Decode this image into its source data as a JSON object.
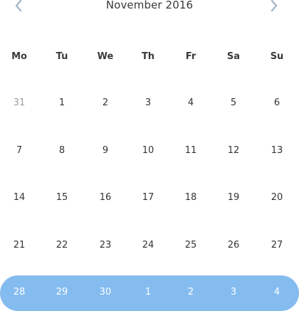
{
  "calendar": {
    "title": "November 2016",
    "weekdays": [
      "Mo",
      "Tu",
      "We",
      "Th",
      "Fr",
      "Sa",
      "Su"
    ],
    "weeks": [
      [
        "31",
        "1",
        "2",
        "3",
        "4",
        "5",
        "6"
      ],
      [
        "7",
        "8",
        "9",
        "10",
        "11",
        "12",
        "13"
      ],
      [
        "14",
        "15",
        "16",
        "17",
        "18",
        "19",
        "20"
      ],
      [
        "21",
        "22",
        "23",
        "24",
        "25",
        "26",
        "27"
      ],
      [
        "28",
        "29",
        "30",
        "1",
        "2",
        "3",
        "4"
      ]
    ],
    "muted_cells": [
      "0-0"
    ],
    "selected_week_index": 4
  },
  "icons": {
    "prev": "chevron-left-icon",
    "next": "chevron-right-icon"
  },
  "colors": {
    "highlight": "#85bcef",
    "text": "#333333",
    "muted": "#9e9e9e",
    "nav": "#a7b6c4"
  }
}
